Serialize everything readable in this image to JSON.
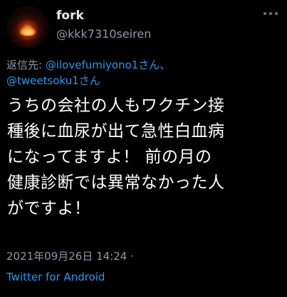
{
  "tweet": {
    "display_name": "fork",
    "handle": "@kkk7310seiren",
    "reply": {
      "prefix": "返信先: ",
      "mention1": "@ilovefumiyono1さん、",
      "mention2": "@tweetsoku1さん"
    },
    "body_lines": [
      "うちの会社の人もワクチン接",
      "種後に血尿が出て急性白血病",
      "になってますよ！  前の月の",
      "健康診断では異常なかった人",
      "がですよ！"
    ],
    "timestamp": "2021年09月26日 14:24 ·",
    "source": "Twitter for Android"
  },
  "icons": {
    "avatar": "campfire-avatar",
    "more": "more-options-icon"
  },
  "colors": {
    "background": "#000000",
    "text": "#ffffff",
    "secondary": "#8b98a5",
    "accent": "#1d9bf0"
  }
}
